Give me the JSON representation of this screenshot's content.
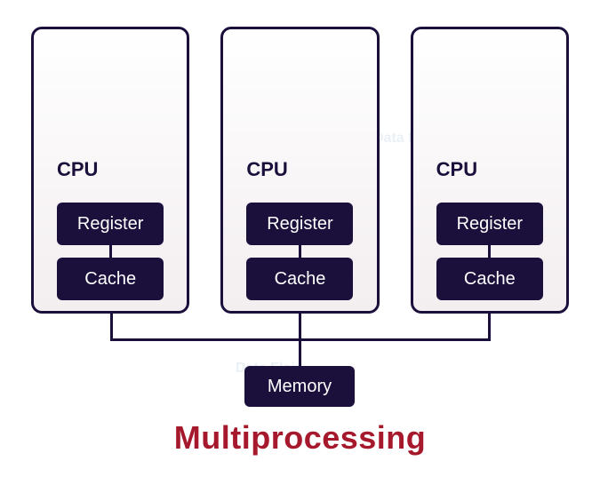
{
  "title": "Multiprocessing",
  "cpus": [
    {
      "label": "CPU",
      "register": "Register",
      "cache": "Cache"
    },
    {
      "label": "CPU",
      "register": "Register",
      "cache": "Cache"
    },
    {
      "label": "CPU",
      "register": "Register",
      "cache": "Cache"
    }
  ],
  "memory": "Memory",
  "watermark": "Data\nFlair",
  "colors": {
    "box_fill": "#1b0f3c",
    "box_text": "#ffffff",
    "cpu_border": "#1b0f3c",
    "title": "#a6182b"
  }
}
